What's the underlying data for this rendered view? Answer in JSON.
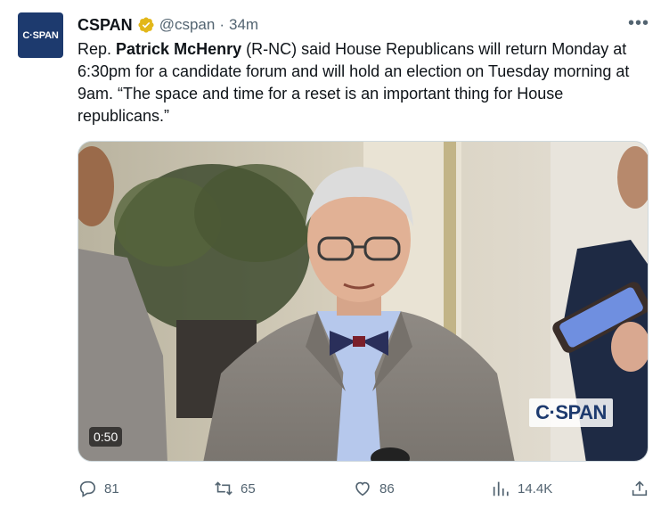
{
  "author": {
    "avatar_text": "C·SPAN",
    "display_name": "CSPAN",
    "handle": "@cspan",
    "separator": "·",
    "time": "34m"
  },
  "tweet": {
    "text_before": "Rep. ",
    "text_bold": "Patrick McHenry",
    "text_after": " (R-NC) said House Republicans will return Monday at 6:30pm for a candidate forum and will hold an election on Tuesday morning at 9am. “The space and time for a reset is an important thing for House republicans.”"
  },
  "media": {
    "duration": "0:50",
    "watermark": "C·SPAN"
  },
  "actions": {
    "replies": "81",
    "retweets": "65",
    "likes": "86",
    "views": "14.4K"
  },
  "more_label": "•••",
  "colors": {
    "accent": "#1d9bf0",
    "secondary_text": "#536471",
    "verified": "#e2b719",
    "cspan_blue": "#1d3a6e"
  }
}
